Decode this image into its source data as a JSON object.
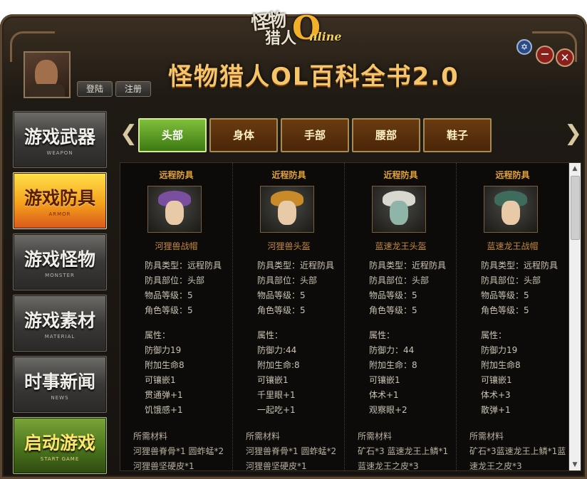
{
  "app": {
    "logo_line1": "怪物",
    "logo_line2": "猎人",
    "logo_zero": "O",
    "logo_online": "nline",
    "title": "怪物猎人OL百科全书2.0"
  },
  "header": {
    "login_label": "登陆",
    "register_label": "注册",
    "settings_glyph": "✡",
    "minimize_glyph": "−",
    "close_glyph": "✕"
  },
  "sidebar": {
    "items": [
      {
        "zh": "游戏武器",
        "en": "WEAPON"
      },
      {
        "zh": "游戏防具",
        "en": "ARMOR"
      },
      {
        "zh": "游戏怪物",
        "en": "MONSTER"
      },
      {
        "zh": "游戏素材",
        "en": "MATERIAL"
      },
      {
        "zh": "时事新闻",
        "en": "NEWS"
      },
      {
        "zh": "启动游戏",
        "en": "START GAME"
      }
    ]
  },
  "tabs": {
    "prev_glyph": "❮",
    "next_glyph": "❯",
    "items": [
      "头部",
      "身体",
      "手部",
      "腰部",
      "鞋子"
    ]
  },
  "armor": [
    {
      "type": "远程防具",
      "name": "河狸兽战帽",
      "lines": [
        "防具类型：远程防具",
        "防具部位：头部",
        "物品等级：5",
        "角色等级：5"
      ],
      "attr_title": "属性：",
      "attrs": [
        "防御力19",
        "附加生命8",
        "可镶嵌1",
        "贯通弹+1",
        "饥饿感+1"
      ],
      "mat_title": "所需材料",
      "mats": [
        "河狸兽脊骨*1 圆蚱蜢*2",
        "河狸兽坚硬皮*1"
      ]
    },
    {
      "type": "近程防具",
      "name": "河狸兽头盔",
      "lines": [
        "防具类型：近程防具",
        "防具部位：头部",
        "物品等级：5",
        "角色等级：5"
      ],
      "attr_title": "属性：",
      "attrs": [
        "防御力:44",
        "附加生命:8",
        "可镶嵌1",
        "千里眼+1",
        "一起吃+1"
      ],
      "mat_title": "所需材料",
      "mats": [
        "河狸兽脊骨*1 圆蚱蜢*2",
        "河狸兽坚硬皮*1"
      ]
    },
    {
      "type": "近程防具",
      "name": "蓝速龙王头盔",
      "lines": [
        "防具类型：近程防具",
        "防具部位：头部",
        "物品等级：5",
        "角色等级：5"
      ],
      "attr_title": "属性：",
      "attrs": [
        "防御力：44",
        "附加生命：8",
        "可镶嵌1",
        "体术+1",
        "观察眼+2"
      ],
      "mat_title": "所需材料",
      "mats": [
        "矿石*3 蓝速龙王上鳞*1",
        "蓝速龙王之皮*3"
      ]
    },
    {
      "type": "远程防具",
      "name": "蓝速龙王战帽",
      "lines": [
        "防具类型：远程防具",
        "防具部位：头部",
        "物品等级：5",
        "角色等级：5"
      ],
      "attr_title": "属性：",
      "attrs": [
        "防御力19",
        "附加生命8",
        "可镶嵌1",
        "体术+3",
        "散弹+1"
      ],
      "mat_title": "所需材料",
      "mats": [
        "矿石*3蓝速龙王上鳞*1蓝",
        "速龙王之皮*3"
      ]
    }
  ],
  "colors": {
    "accent_gold": "#e0a238",
    "active_tab": "#3c7a12",
    "active_sidebar": "#f5a11c"
  }
}
